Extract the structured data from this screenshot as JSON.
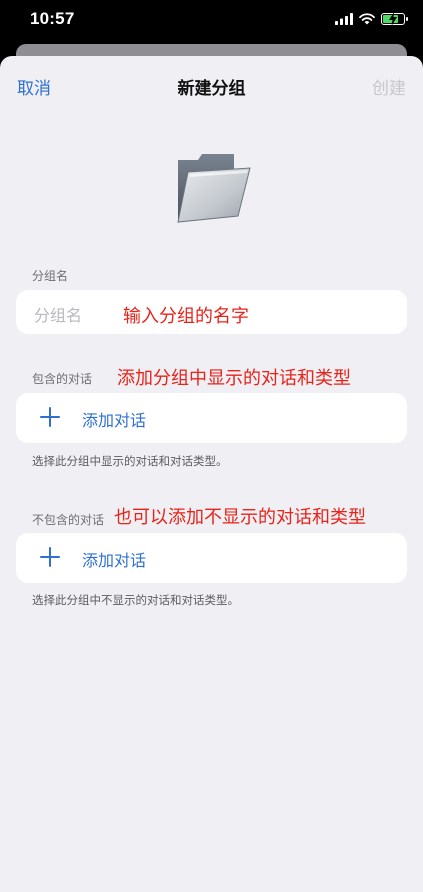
{
  "status": {
    "time": "10:57"
  },
  "nav": {
    "cancel": "取消",
    "title": "新建分组",
    "create": "创建"
  },
  "name_section": {
    "label": "分组名",
    "placeholder": "分组名"
  },
  "include_section": {
    "label": "包含的对话",
    "add_label": "添加对话",
    "note": "选择此分组中显示的对话和对话类型。"
  },
  "exclude_section": {
    "label": "不包含的对话",
    "add_label": "添加对话",
    "note": "选择此分组中不显示的对话和对话类型。"
  },
  "annotations": {
    "name": "输入分组的名字",
    "include": "添加分组中显示的对话和类型",
    "exclude": "也可以添加不显示的对话和类型"
  },
  "colors": {
    "accent": "#2f6fd1",
    "annotation": "#e8231a",
    "background": "#efeff4",
    "battery": "#4cd964"
  },
  "icons": [
    "signal-icon",
    "wifi-icon",
    "battery-icon",
    "folder-icon",
    "plus-icon"
  ]
}
